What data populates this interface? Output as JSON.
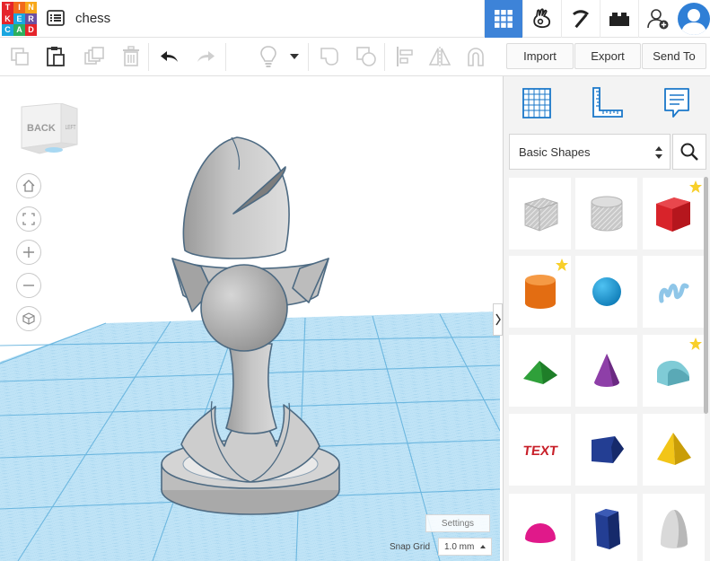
{
  "app": {
    "logo_letters": [
      "T",
      "I",
      "N",
      "K",
      "E",
      "R",
      "C",
      "A",
      "D"
    ],
    "logo_colors": [
      "#e5242a",
      "#f26a1b",
      "#f8a81a",
      "#e5242a",
      "#1aa6e0",
      "#6c4fa1",
      "#1aa6e0",
      "#2db05f",
      "#e5242a"
    ],
    "project_title": "chess",
    "accent_color": "#3d83d8"
  },
  "topbar": {
    "buttons": [
      {
        "name": "grid-view-icon",
        "active": true
      },
      {
        "name": "blocks-view-icon",
        "active": false
      },
      {
        "name": "pickaxe-icon",
        "active": false
      },
      {
        "name": "bricks-icon",
        "active": false
      },
      {
        "name": "add-user-icon",
        "active": false
      }
    ]
  },
  "toolbar": {
    "import_label": "Import",
    "export_label": "Export",
    "send_to_label": "Send To"
  },
  "viewcube": {
    "back_label": "BACK",
    "left_label": "LEFT"
  },
  "viewport": {
    "settings_label": "Settings",
    "snap_grid_label": "Snap Grid",
    "snap_grid_value": "1.0 mm"
  },
  "panel": {
    "category": "Basic Shapes",
    "shapes": [
      {
        "name": "box-hole-shape",
        "starred": false
      },
      {
        "name": "cylinder-hole-shape",
        "starred": false
      },
      {
        "name": "box-shape",
        "starred": true
      },
      {
        "name": "cylinder-shape",
        "starred": true
      },
      {
        "name": "sphere-shape",
        "starred": false
      },
      {
        "name": "scribble-shape",
        "starred": false
      },
      {
        "name": "roof-shape",
        "starred": false
      },
      {
        "name": "cone-shape",
        "starred": false
      },
      {
        "name": "round-roof-shape",
        "starred": true
      },
      {
        "name": "text-shape",
        "starred": false
      },
      {
        "name": "polygon-shape",
        "starred": false
      },
      {
        "name": "pyramid-shape",
        "starred": false
      },
      {
        "name": "half-sphere-shape",
        "starred": false
      },
      {
        "name": "hexagonal-prism-shape",
        "starred": false
      },
      {
        "name": "paraboloid-shape",
        "starred": false
      }
    ],
    "shape_text_preview": "TEXT",
    "colors": {
      "box": "#d8232a",
      "cylinder": "#f07d1b",
      "sphere": "#1a9bd7",
      "scribble": "#8fc6e8",
      "roof": "#2fa03a",
      "cone": "#8e3fa8",
      "round_roof": "#7fcbd6",
      "text": "#c8202a",
      "polygon": "#233e93",
      "pyramid": "#f2c518",
      "half_sphere": "#e0198a",
      "hex_prism": "#233e93",
      "paraboloid": "#d9d9d9",
      "star": "#f8cf2a"
    }
  }
}
